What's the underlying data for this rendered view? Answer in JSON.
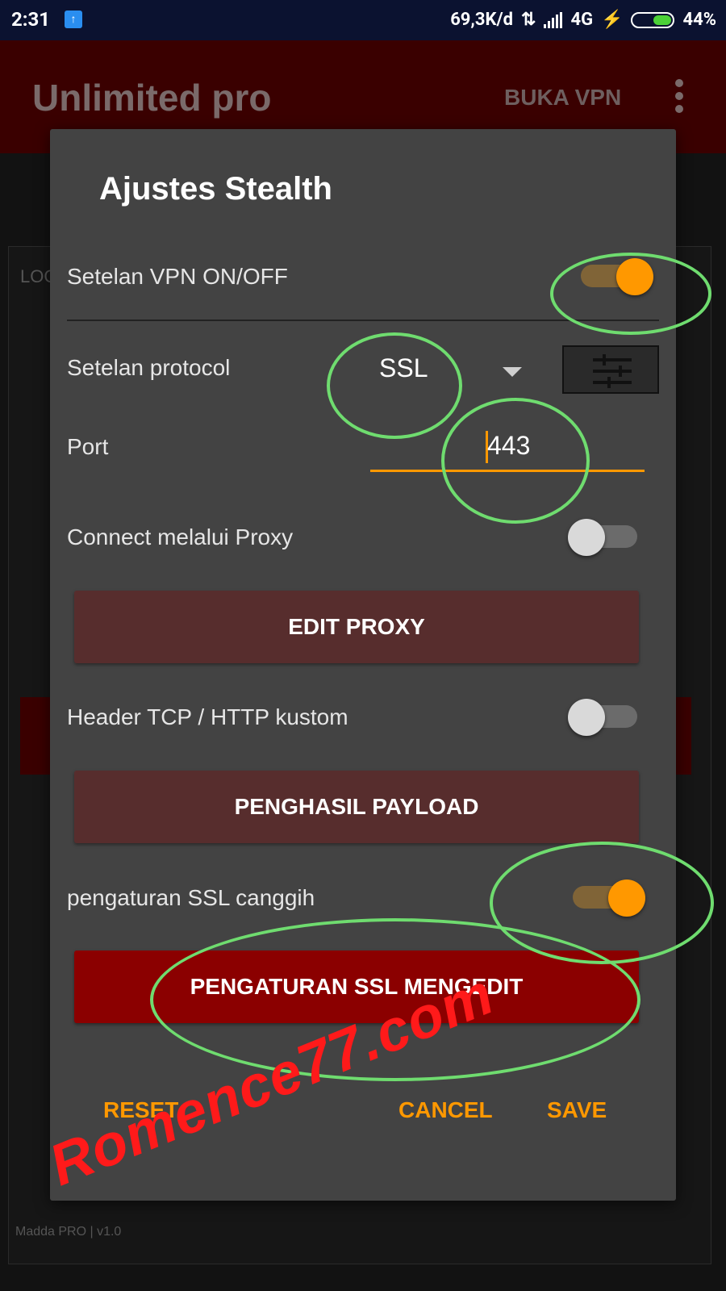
{
  "status_bar": {
    "time": "2:31",
    "speed": "69,3K/d",
    "network": "4G",
    "battery": "44%"
  },
  "app_bar": {
    "title": "Unlimited pro",
    "action": "BUKA VPN"
  },
  "background": {
    "log_label": "LOG",
    "footer": "Madda PRO | v1.0"
  },
  "dialog": {
    "title": "Ajustes Stealth",
    "vpn_toggle": {
      "label": "Setelan VPN ON/OFF",
      "on": true
    },
    "protocol": {
      "label": "Setelan protocol",
      "value": "SSL"
    },
    "port": {
      "label": "Port",
      "value": "443"
    },
    "proxy_toggle": {
      "label": "Connect melalui Proxy",
      "on": false
    },
    "edit_proxy_label": "EDIT PROXY",
    "header_toggle": {
      "label": "Header TCP / HTTP kustom",
      "on": false
    },
    "payload_label": "PENGHASIL PAYLOAD",
    "ssl_toggle": {
      "label": "pengaturan SSL canggih",
      "on": true
    },
    "ssl_edit_label": "PENGATURAN SSL MENGEDIT",
    "actions": {
      "reset": "RESET",
      "cancel": "CANCEL",
      "save": "SAVE"
    }
  },
  "watermark": "Romence77.com",
  "colors": {
    "accent": "#ff9800",
    "primary_button": "#8b0000",
    "muted_button": "#572d2d",
    "annotation": "#6fdc6f",
    "watermark": "#ff1a1a"
  }
}
